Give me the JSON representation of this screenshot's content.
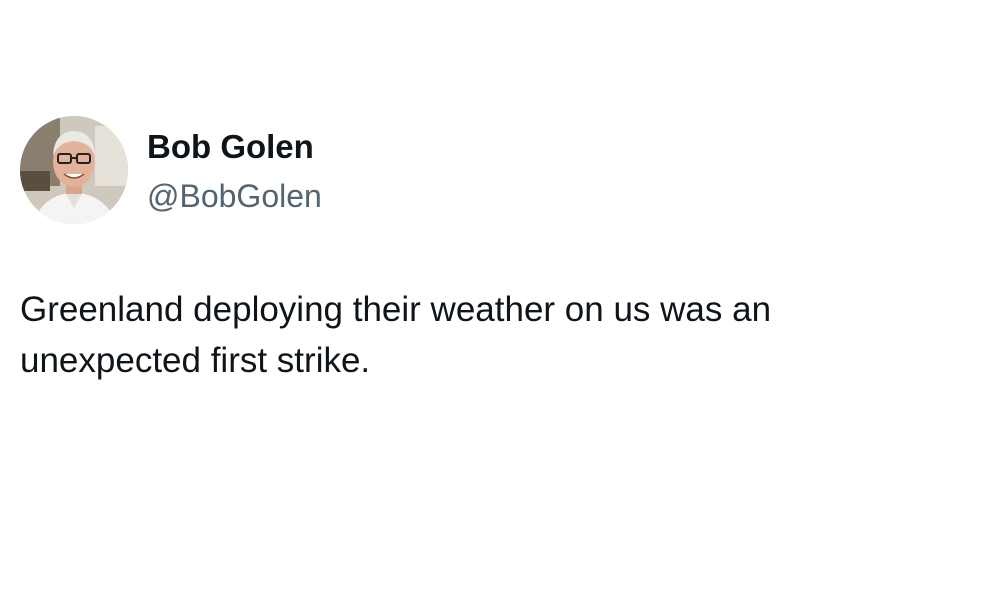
{
  "tweet": {
    "author": {
      "display_name": "Bob Golen",
      "handle": "@BobGolen",
      "avatar_icon": "profile-photo"
    },
    "text_lines": [
      "Greenland deploying their weather on us was an",
      "unexpected first strike."
    ]
  }
}
